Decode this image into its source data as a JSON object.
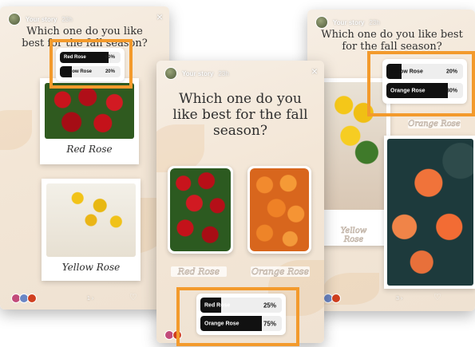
{
  "story": {
    "user": "Your story",
    "time": "23h",
    "question": "Which one do you like best for the fall season?",
    "close": "×"
  },
  "left_panel": {
    "poll": [
      {
        "option": "Red Rose",
        "percent": "80",
        "fill": 0.8
      },
      {
        "option": "Yellow Rose",
        "percent": "20",
        "fill": 0.2
      }
    ],
    "label_top": "Red Rose",
    "label_bottom": "Yellow Rose",
    "viewers_count": "1 ›"
  },
  "center_panel": {
    "poll": [
      {
        "option": "Red Rose",
        "percent": "25",
        "fill": 0.25
      },
      {
        "option": "Orange Rose",
        "percent": "75",
        "fill": 0.75
      }
    ],
    "label_left": "Red Rose",
    "label_right": "Orange Rose",
    "pct_suffix": "%"
  },
  "right_panel": {
    "poll": [
      {
        "option": "Yellow Rose",
        "percent": "20",
        "fill": 0.2
      },
      {
        "option": "Orange Rose",
        "percent": "80",
        "fill": 0.8
      }
    ],
    "label_top": "Orange Rose",
    "label_mid": "Yellow Rose",
    "viewers_count": "3 ›"
  },
  "colors": {
    "highlight": "#f39a2c",
    "poll_fill": "#111111",
    "background": "#f3e6d6"
  }
}
